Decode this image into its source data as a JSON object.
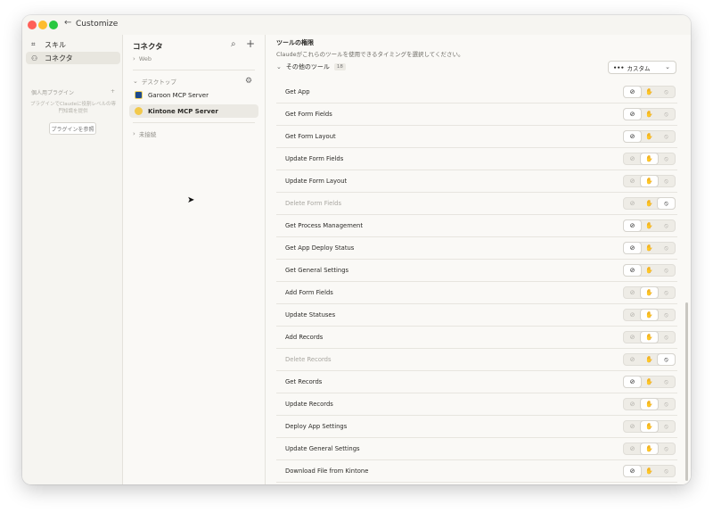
{
  "window": {
    "title": "Customize",
    "back_glyph": "←"
  },
  "sidebar": {
    "items": [
      {
        "label": "スキル",
        "icon": "skill-icon",
        "glyph": "⌗"
      },
      {
        "label": "コネクタ",
        "icon": "connector-icon",
        "glyph": "⚇"
      }
    ],
    "section_label": "個人用プラグイン",
    "section_add": "+",
    "note": "プラグインでClaudeに役割レベルの専門知識を提供",
    "browse_button": "プラグインを参照"
  },
  "connectors": {
    "title": "コネクタ",
    "search_glyph": "⌕",
    "add_glyph": "+",
    "group_web": "Web",
    "group_desktop": "デスクトップ",
    "group_unconnected": "未接続",
    "servers": [
      {
        "label": "Garoon MCP Server",
        "icon": "garoon-logo-icon"
      },
      {
        "label": "Kintone MCP Server",
        "icon": "kintone-logo-icon"
      }
    ]
  },
  "main": {
    "title": "ツールの権限",
    "subtitle": "Claudeがこれらのツールを使用できるタイミングを選択してください。",
    "others_label": "その他のツール",
    "others_count": "18",
    "mode_label": "カスタム",
    "mode_dots": "•••",
    "tools": [
      {
        "name": "Get App",
        "selected": "always",
        "dim": false
      },
      {
        "name": "Get Form Fields",
        "selected": "always",
        "dim": false
      },
      {
        "name": "Get Form Layout",
        "selected": "always",
        "dim": false
      },
      {
        "name": "Update Form Fields",
        "selected": "ask",
        "dim": false
      },
      {
        "name": "Update Form Layout",
        "selected": "ask",
        "dim": false
      },
      {
        "name": "Delete Form Fields",
        "selected": "block",
        "dim": true
      },
      {
        "name": "Get Process Management",
        "selected": "always",
        "dim": false
      },
      {
        "name": "Get App Deploy Status",
        "selected": "always",
        "dim": false
      },
      {
        "name": "Get General Settings",
        "selected": "always",
        "dim": false
      },
      {
        "name": "Add Form Fields",
        "selected": "ask",
        "dim": false
      },
      {
        "name": "Update Statuses",
        "selected": "ask",
        "dim": false
      },
      {
        "name": "Add Records",
        "selected": "ask",
        "dim": false
      },
      {
        "name": "Delete Records",
        "selected": "block",
        "dim": true
      },
      {
        "name": "Get Records",
        "selected": "always",
        "dim": false
      },
      {
        "name": "Update Records",
        "selected": "ask",
        "dim": false
      },
      {
        "name": "Deploy App Settings",
        "selected": "ask",
        "dim": false
      },
      {
        "name": "Update General Settings",
        "selected": "ask",
        "dim": false
      },
      {
        "name": "Download File from Kintone",
        "selected": "always",
        "dim": false
      }
    ],
    "glyphs": {
      "always": "⊘",
      "ask": "✋",
      "block": "⦸"
    }
  }
}
